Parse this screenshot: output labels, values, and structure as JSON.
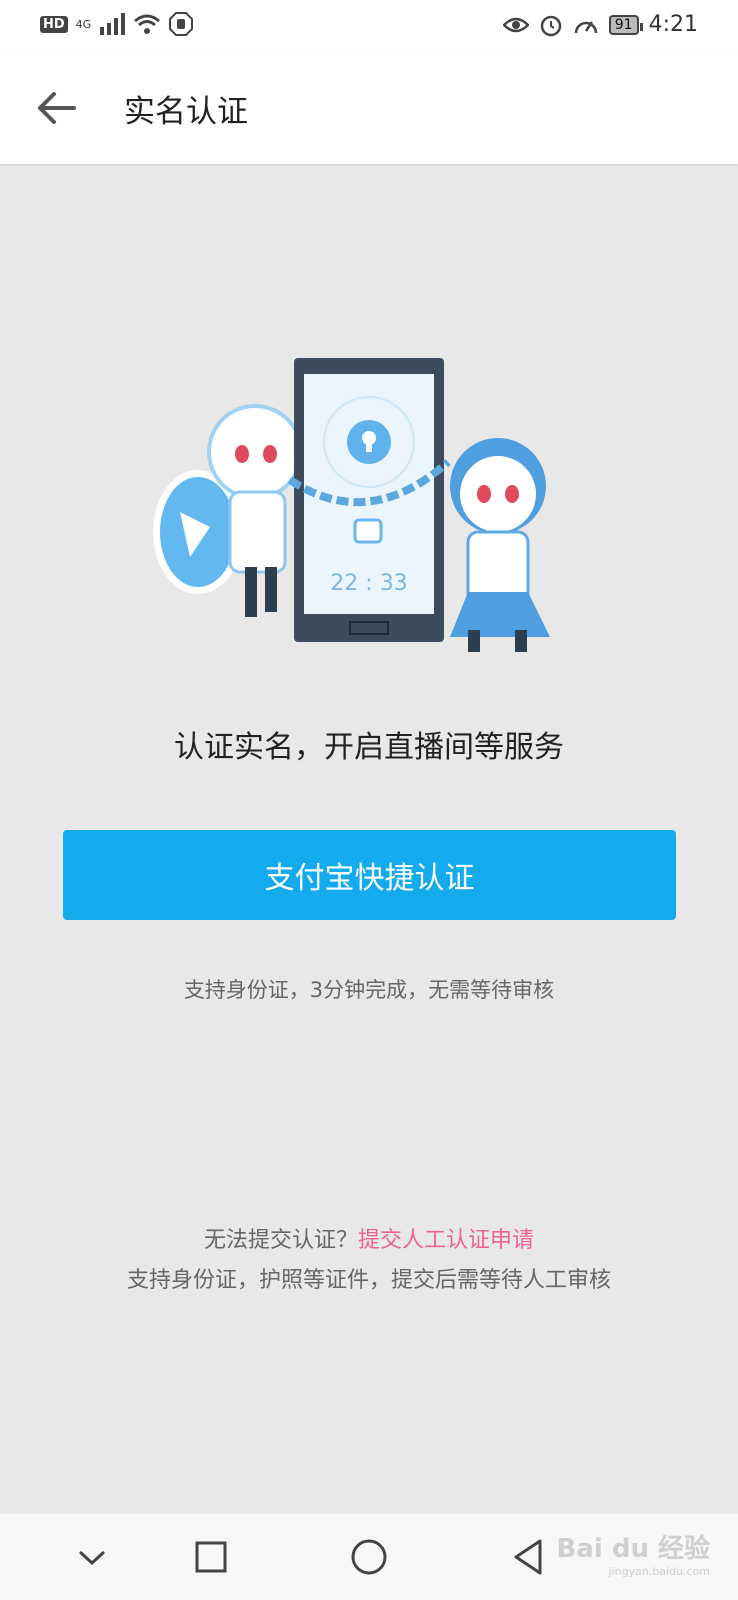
{
  "status_bar": {
    "hd": "HD",
    "network": "4G",
    "time": "4:21",
    "battery": "91"
  },
  "header": {
    "title": "实名认证"
  },
  "main": {
    "illustration_clock": "22 : 33",
    "tagline": "认证实名，开启直播间等服务",
    "primary_button": "支付宝快捷认证",
    "hint": "支持身份证，3分钟完成，无需等待审核",
    "manual_prefix": "无法提交认证？",
    "manual_link": "提交人工认证申请",
    "manual_sub": "支持身份证，护照等证件，提交后需等待人工审核"
  },
  "watermark": {
    "brand": "Bai du 经验",
    "domain": "jingyan.baidu.com"
  },
  "colors": {
    "primary": "#13aaee",
    "link": "#f0638e",
    "background": "#e8e8e8"
  }
}
